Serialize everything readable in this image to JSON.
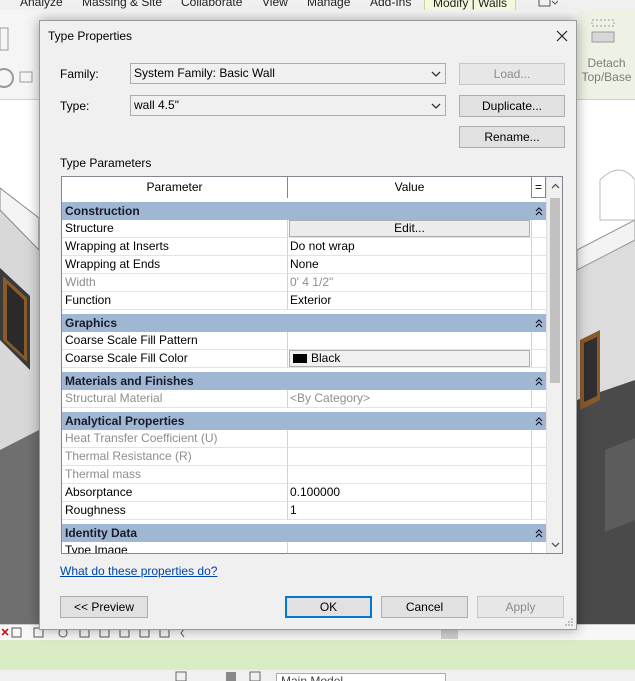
{
  "app": {
    "ribbon_tabs": [
      "Analyze",
      "Massing & Site",
      "Collaborate",
      "View",
      "Manage",
      "Add-Ins",
      "Modify | Walls"
    ],
    "detach_label": "Detach Top/Base",
    "view_selector": "Main Model"
  },
  "dialog": {
    "title": "Type Properties",
    "family_label": "Family:",
    "family_value": "System Family: Basic Wall",
    "type_label": "Type:",
    "type_value": "wall 4.5\"",
    "load_button": "Load...",
    "duplicate_button": "Duplicate...",
    "rename_button": "Rename...",
    "type_parameters_label": "Type Parameters",
    "grid": {
      "col_parameter": "Parameter",
      "col_value": "Value",
      "sort_symbol": "=",
      "groups": [
        {
          "name": "Construction",
          "rows": [
            {
              "param": "Structure",
              "value": "Edit...",
              "kind": "button"
            },
            {
              "param": "Wrapping at Inserts",
              "value": "Do not wrap"
            },
            {
              "param": "Wrapping at Ends",
              "value": "None"
            },
            {
              "param": "Width",
              "value": "0'  4 1/2\"",
              "disabled": true
            },
            {
              "param": "Function",
              "value": "Exterior"
            }
          ]
        },
        {
          "name": "Graphics",
          "rows": [
            {
              "param": "Coarse Scale Fill Pattern",
              "value": ""
            },
            {
              "param": "Coarse Scale Fill Color",
              "value": "Black",
              "kind": "color",
              "color": "#000000"
            }
          ]
        },
        {
          "name": "Materials and Finishes",
          "rows": [
            {
              "param": "Structural Material",
              "value": "<By Category>",
              "disabled": true
            }
          ]
        },
        {
          "name": "Analytical Properties",
          "rows": [
            {
              "param": "Heat Transfer Coefficient (U)",
              "value": "",
              "disabled": true
            },
            {
              "param": "Thermal Resistance (R)",
              "value": "",
              "disabled": true
            },
            {
              "param": "Thermal mass",
              "value": "",
              "disabled": true
            },
            {
              "param": "Absorptance",
              "value": "0.100000"
            },
            {
              "param": "Roughness",
              "value": "1"
            }
          ]
        },
        {
          "name": "Identity Data",
          "rows": [
            {
              "param": "Type Image",
              "value": ""
            }
          ]
        }
      ]
    },
    "help_link": "What do these properties do?",
    "preview_button": "<< Preview",
    "ok_button": "OK",
    "cancel_button": "Cancel",
    "apply_button": "Apply"
  },
  "colors": {
    "group_header": "#9fb7d2",
    "link": "#0045a8",
    "default_button_border": "#0078d7"
  }
}
